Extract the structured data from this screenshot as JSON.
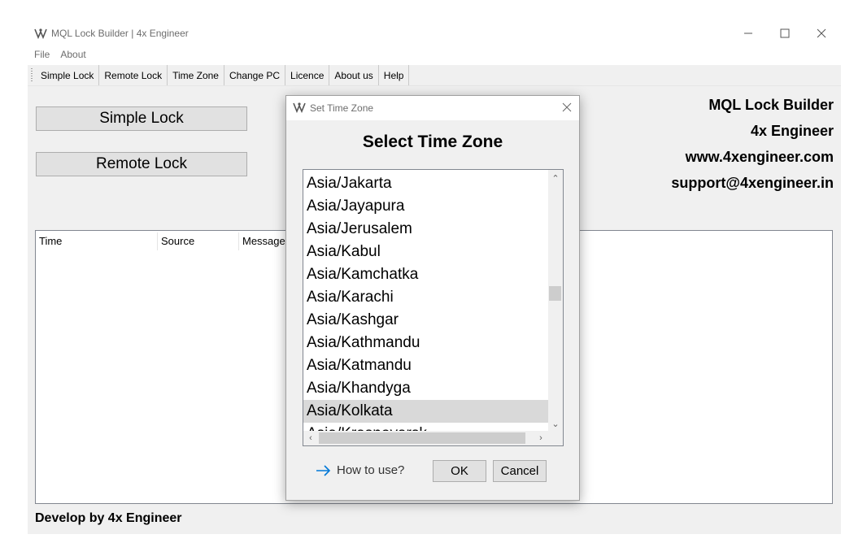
{
  "window": {
    "title": "MQL Lock Builder | 4x Engineer",
    "icon": "app-logo-icon"
  },
  "menu": [
    "File",
    "About"
  ],
  "toolbar": [
    "Simple Lock",
    "Remote Lock",
    "Time Zone",
    "Change PC",
    "Licence",
    "About us",
    "Help"
  ],
  "main": {
    "simple_lock_button": "Simple Lock",
    "remote_lock_button": "Remote Lock",
    "info": {
      "app_name": "MQL Lock Builder",
      "company": "4x Engineer",
      "website": "www.4xengineer.com",
      "email": "support@4xengineer.in"
    },
    "log_columns": [
      "Time",
      "Source",
      "Message"
    ],
    "footer": "Develop by 4x Engineer"
  },
  "dialog": {
    "title": "Set Time Zone",
    "heading": "Select Time Zone",
    "timezones": [
      "Asia/Jakarta",
      "Asia/Jayapura",
      "Asia/Jerusalem",
      "Asia/Kabul",
      "Asia/Kamchatka",
      "Asia/Karachi",
      "Asia/Kashgar",
      "Asia/Kathmandu",
      "Asia/Katmandu",
      "Asia/Khandyga",
      "Asia/Kolkata",
      "Asia/Krasnoyarsk"
    ],
    "selected": "Asia/Kolkata",
    "how_to_link": "How to use?",
    "ok_button": "OK",
    "cancel_button": "Cancel"
  },
  "colors": {
    "client_bg": "#f0f0f0",
    "selected_row": "#d9d9d9",
    "link_arrow": "#0078d7"
  }
}
